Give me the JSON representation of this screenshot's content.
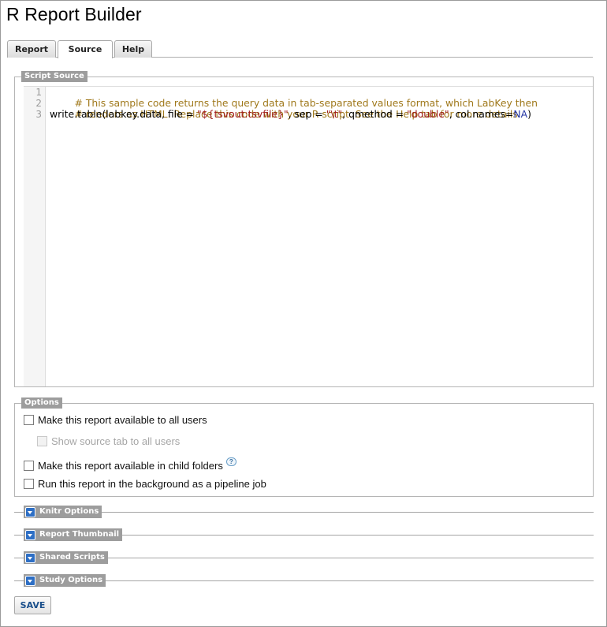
{
  "page": {
    "title": "R Report Builder"
  },
  "tabs": [
    {
      "label": "Report"
    },
    {
      "label": "Source"
    },
    {
      "label": "Help"
    }
  ],
  "script_source": {
    "legend": "Script Source",
    "line_numbers": [
      "1",
      "2",
      "3"
    ],
    "lines": [
      {
        "comment": "# This sample code returns the query data in tab-separated values format, which LabKey then"
      },
      {
        "comment": "# renders as HTML. Replace this code with your R script. See the Help tab for more details."
      },
      {
        "p1": "write.table(labkey.data, file = ",
        "s1": "\"${tsvout:tsvfile}\"",
        "p2": ", sep = ",
        "s2": "\"\\t\"",
        "p3": ", qmethod = ",
        "s3": "\"double\"",
        "p4": ", col.names=",
        "c1": "NA",
        "p5": ")"
      }
    ]
  },
  "options": {
    "legend": "Options",
    "items": [
      {
        "label": "Make this report available to all users",
        "checked": false,
        "disabled": false
      },
      {
        "label": "Show source tab to all users",
        "checked": false,
        "disabled": true
      },
      {
        "label": "Make this report available in child folders",
        "checked": false,
        "disabled": false
      },
      {
        "label": "Run this report in the background as a pipeline job",
        "checked": false,
        "disabled": false
      }
    ],
    "help_icon_glyph": "?"
  },
  "sections": [
    {
      "label": "Knitr Options"
    },
    {
      "label": "Report Thumbnail"
    },
    {
      "label": "Shared Scripts"
    },
    {
      "label": "Study Options"
    }
  ],
  "save_label": "SAVE"
}
